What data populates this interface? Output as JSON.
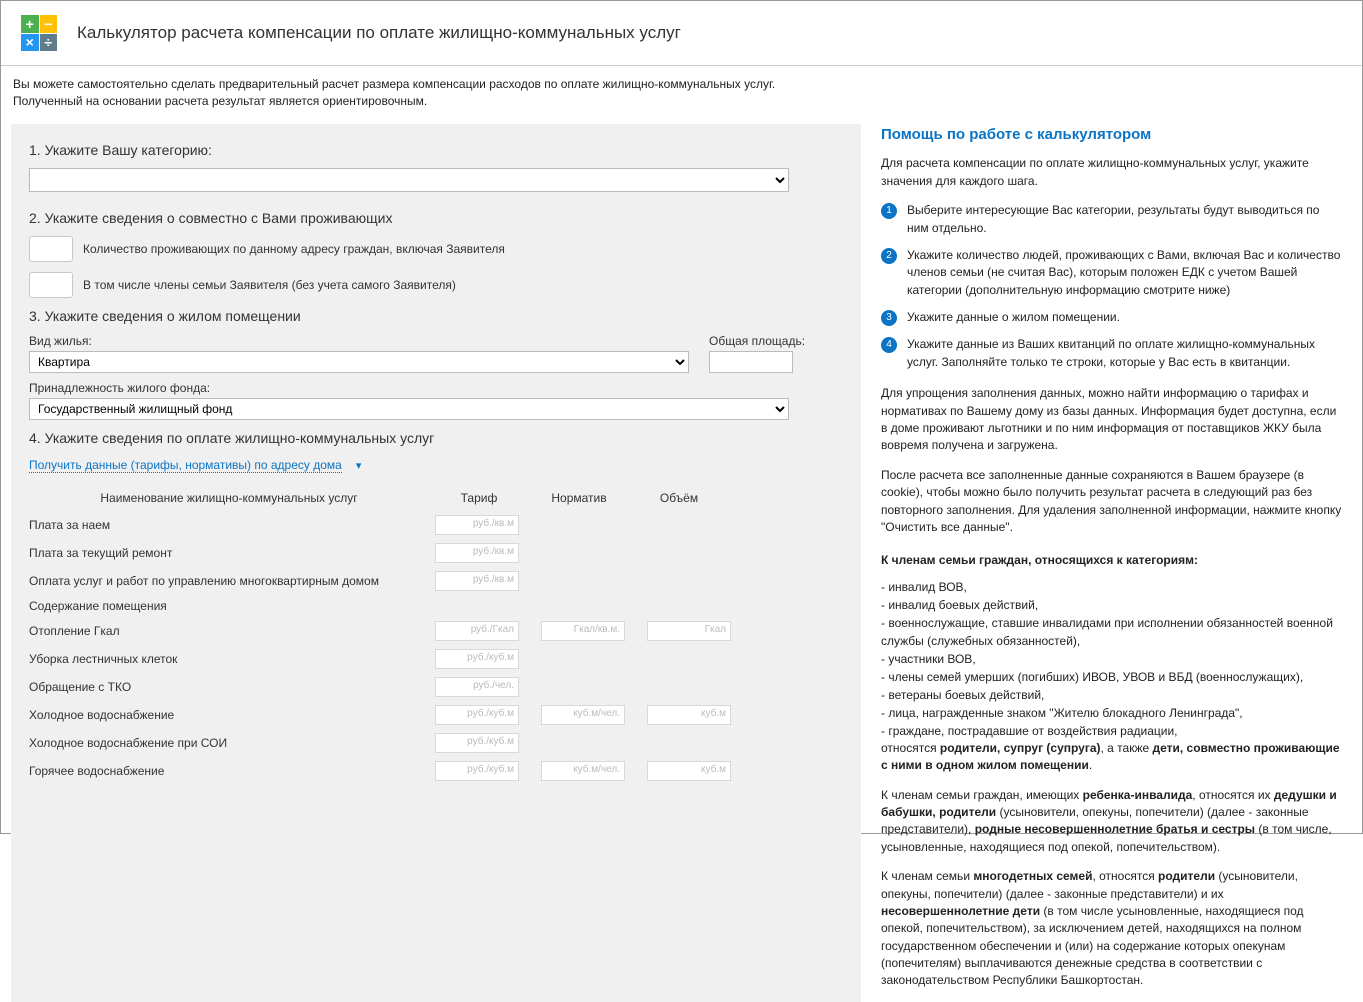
{
  "header": {
    "title": "Калькулятор расчета компенсации по оплате жилищно-коммунальных услуг"
  },
  "intro": {
    "line1": "Вы можете самостоятельно сделать предварительный расчет размера компенсации расходов по оплате жилищно-коммунальных услуг.",
    "line2": "Полученный на основании расчета результат является ориентировочным."
  },
  "form": {
    "step1": {
      "heading": "1. Укажите Вашу категорию:"
    },
    "step2": {
      "heading": "2. Укажите сведения о совместно с Вами проживающих",
      "row1": "Количество проживающих по данному адресу граждан, включая Заявителя",
      "row2": "В том числе члены семьи Заявителя (без учета самого Заявителя)"
    },
    "step3": {
      "heading": "3. Укажите сведения о жилом помещении",
      "type_label": "Вид жилья:",
      "type_value": "Квартира",
      "area_label": "Общая площадь:",
      "fund_label": "Принадлежность жилого фонда:",
      "fund_value": "Государственный жилищный фонд"
    },
    "step4": {
      "heading": "4. Укажите сведения по оплате жилищно-коммунальных услуг",
      "link": "Получить данные (тарифы, нормативы) по адресу дома"
    }
  },
  "util": {
    "cols": {
      "name": "Наименование жилищно-коммунальных услуг",
      "tariff": "Тариф",
      "norm": "Норматив",
      "volume": "Объём"
    },
    "rows": [
      {
        "name": "Плата за наем",
        "t": "руб./кв.м",
        "n": "",
        "v": ""
      },
      {
        "name": "Плата за текущий ремонт",
        "t": "руб./кв.м",
        "n": "",
        "v": ""
      },
      {
        "name": "Оплата услуг и работ по управлению многоквартирным домом",
        "t": "руб./кв.м",
        "n": "",
        "v": ""
      },
      {
        "name": "Содержание помещения",
        "t": "",
        "n": "",
        "v": ""
      },
      {
        "name": "Отопление Гкал",
        "t": "руб./Гкал",
        "n": "Гкал/кв.м.",
        "v": "Гкал"
      },
      {
        "name": "Уборка лестничных клеток",
        "t": "руб./куб.м",
        "n": "",
        "v": ""
      },
      {
        "name": "Обращение с ТКО",
        "t": "руб./чел.",
        "n": "",
        "v": ""
      },
      {
        "name": "Холодное водоснабжение",
        "t": "руб./куб.м",
        "n": "куб.м/чел.",
        "v": "куб.м"
      },
      {
        "name": "Холодное водоснабжение при СОИ",
        "t": "руб./куб.м",
        "n": "",
        "v": ""
      },
      {
        "name": "Горячее водоснабжение",
        "t": "руб./куб.м",
        "n": "куб.м/чел.",
        "v": "куб.м"
      }
    ]
  },
  "help": {
    "title": "Помощь по работе с калькулятором",
    "intro": "Для расчета компенсации по оплате жилищно-коммунальных услуг, укажите значения для каждого шага.",
    "steps": [
      "Выберите интересующие Вас категории, результаты будут выводиться по ним отдельно.",
      "Укажите количество людей, проживающих с Вами, включая Вас и количество членов семьи (не считая Вас), которым положен ЕДК с учетом Вашей категории (дополнительную информацию смотрите ниже)",
      "Укажите данные о жилом помещении.",
      "Укажите данные из Ваших квитанций по оплате жилищно-коммунальных услуг. Заполняйте только те строки, которые у Вас есть в квитанции."
    ],
    "p1": "Для упрощения заполнения данных, можно найти информацию о тарифах и нормативах по Вашему дому из базы данных. Информация будет доступна, если в доме проживают льготники и по ним информация от поставщиков ЖКУ была вовремя получена и загружена.",
    "p2": "После расчета все заполненные данные сохраняются в Вашем браузере (в cookie), чтобы можно было получить результат расчета в следующий раз без повторного заполнения. Для удаления заполненной информации, нажмите кнопку \"Очистить все данные\".",
    "sub": "К членам семьи граждан, относящихся к категориям:",
    "cats": [
      "- инвалид ВОВ,",
      "- инвалид боевых действий,",
      "- военнослужащие, ставшие инвалидами при исполнении обязанностей военной службы (служебных обязанностей),",
      "- участники ВОВ,",
      "- члены семей умерших (погибших) ИВОВ, УВОВ и ВБД (военнослужащих),",
      "- ветераны боевых действий,",
      "- лица, награжденные знаком \"Жителю блокадного Ленинграда\",",
      "- граждане, пострадавшие от воздействия радиации,"
    ],
    "p3_pre": "относятся ",
    "p3_b1": "родители, супруг (супруга)",
    "p3_mid": ", а также ",
    "p3_b2": "дети, совместно проживающие с ними в одном жилом помещении",
    "p3_end": ".",
    "p4_pre": "К членам семьи граждан, имеющих ",
    "p4_b1": "ребенка-инвалида",
    "p4_mid1": ", относятся их ",
    "p4_b2": "дедушки и бабушки, родители",
    "p4_mid2": " (усыновители, опекуны, попечители) (далее - законные представители), ",
    "p4_b3": "родные несовершеннолетние братья и сестры",
    "p4_end": " (в том числе, усыновленные, находящиеся под опекой, попечительством).",
    "p5_pre": "К членам семьи ",
    "p5_b1": "многодетных семей",
    "p5_mid1": ", относятся ",
    "p5_b2": "родители",
    "p5_mid2": " (усыновители, опекуны, попечители) (далее - законные представители) и их ",
    "p5_b3": "несовершеннолетние дети",
    "p5_end": " (в том числе усыновленные, находящиеся под опекой, попечительством), за исключением детей, находящихся на полном государственном обеспечении и (или) на содержание которых опекунам (попечителям) выплачиваются денежные средства в соответствии с законодательством Республики Башкортостан."
  }
}
